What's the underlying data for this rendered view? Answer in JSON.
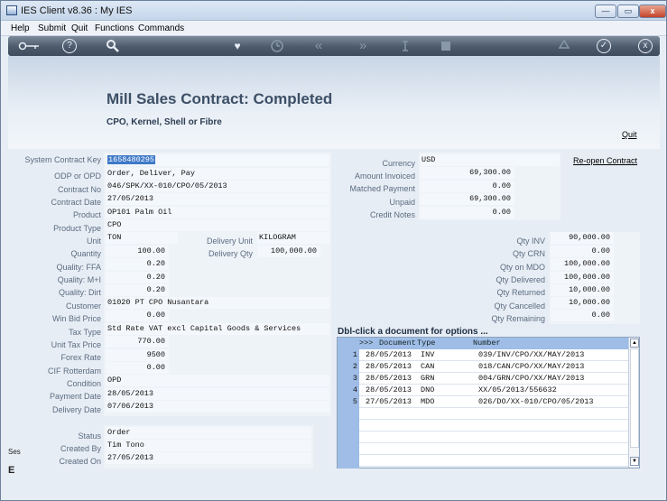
{
  "window": {
    "title": "IES Client v8.36 : My IES",
    "controls": {
      "minimize": "—",
      "maximize": "▭",
      "close": "x"
    }
  },
  "menu": [
    "Help",
    "Submit",
    "Quit",
    "Functions",
    "Commands"
  ],
  "toolbar": {
    "icons": [
      "key-icon",
      "help-icon",
      "search-icon",
      "heart-icon",
      "clock-icon",
      "rewind-icon",
      "forward-icon",
      "cursor-icon",
      "stop-icon",
      "recycle-icon",
      "check-icon",
      "close-icon"
    ],
    "help": "?",
    "fav": "♥",
    "rew": "«",
    "fwd": "»",
    "check": "✓",
    "close": "x"
  },
  "page": {
    "title": "Mill Sales Contract: Completed",
    "subtitle": "CPO, Kernel, Shell or Fibre",
    "quit": "Quit",
    "reopen": "Re-open Contract"
  },
  "left": {
    "system_contract_key": {
      "label": "System Contract Key",
      "value": "1658480295"
    },
    "odp": {
      "label": "ODP or OPD",
      "value": "Order, Deliver, Pay"
    },
    "contract_no": {
      "label": "Contract No",
      "value": "046/SPK/XX-010/CPO/05/2013"
    },
    "contract_date": {
      "label": "Contract Date",
      "value": "27/05/2013"
    },
    "product": {
      "label": "Product",
      "value": "OP101 Palm Oil"
    },
    "product_type": {
      "label": "Product Type",
      "value": "CPO"
    },
    "unit": {
      "label": "Unit",
      "value": "TON"
    },
    "delivery_unit": {
      "label": "Delivery Unit",
      "value": "KILOGRAM"
    },
    "quantity": {
      "label": "Quantity",
      "value": "100.00"
    },
    "delivery_qty": {
      "label": "Delivery Qty",
      "value": "100,000.00"
    },
    "ffa": {
      "label": "Quality: FFA",
      "value": "0.20"
    },
    "mi": {
      "label": "Quality: M+I",
      "value": "0.20"
    },
    "dirt": {
      "label": "Quality: Dirt",
      "value": "0.20"
    },
    "customer": {
      "label": "Customer",
      "value": "01020 PT CPO Nusantara"
    },
    "win_bid": {
      "label": "Win Bid Price",
      "value": "0.00"
    },
    "tax_type": {
      "label": "Tax Type",
      "value": "Std Rate VAT excl Capital Goods & Services"
    },
    "unit_tax": {
      "label": "Unit Tax Price",
      "value": "770.00"
    },
    "forex": {
      "label": "Forex Rate",
      "value": "9500"
    },
    "cif": {
      "label": "CIF Rotterdam",
      "value": "0.00"
    },
    "condition": {
      "label": "Condition",
      "value": "OPD"
    },
    "payment_date": {
      "label": "Payment Date",
      "value": "28/05/2013"
    },
    "delivery_date": {
      "label": "Delivery Date",
      "value": "07/06/2013"
    },
    "status": {
      "label": "Status",
      "value": "Order"
    },
    "created_by": {
      "label": "Created By",
      "value": "Tim Tono"
    },
    "created_on": {
      "label": "Created On",
      "value": "27/05/2013"
    }
  },
  "right": {
    "currency": {
      "label": "Currency",
      "value": "USD"
    },
    "amount_invoiced": {
      "label": "Amount Invoiced",
      "value": "69,300.00"
    },
    "matched_payment": {
      "label": "Matched Payment",
      "value": "0.00"
    },
    "unpaid": {
      "label": "Unpaid",
      "value": "69,300.00"
    },
    "credit_notes": {
      "label": "Credit Notes",
      "value": "0.00"
    },
    "qty_inv": {
      "label": "Qty INV",
      "value": "90,000.00"
    },
    "qty_crn": {
      "label": "Qty CRN",
      "value": "0.00"
    },
    "qty_mdo": {
      "label": "Qty on MDO",
      "value": "100,000.00"
    },
    "qty_delivered": {
      "label": "Qty Delivered",
      "value": "100,000.00"
    },
    "qty_returned": {
      "label": "Qty Returned",
      "value": "10,000.00"
    },
    "qty_cancelled": {
      "label": "Qty Cancelled",
      "value": "10,000.00"
    },
    "qty_remaining": {
      "label": "Qty Remaining",
      "value": "0.00"
    }
  },
  "grid": {
    "title": "Dbl-click a document for options ...",
    "headers": {
      "marker": ">>>",
      "document": "Document",
      "type": "Type",
      "number": "Number"
    },
    "rows": [
      {
        "n": "1",
        "date": "28/05/2013",
        "type": "INV",
        "number": "039/INV/CPO/XX/MAY/2013"
      },
      {
        "n": "2",
        "date": "28/05/2013",
        "type": "CAN",
        "number": "018/CAN/CPO/XX/MAY/2013"
      },
      {
        "n": "3",
        "date": "28/05/2013",
        "type": "GRN",
        "number": "004/GRN/CPO/XX/MAY/2013"
      },
      {
        "n": "4",
        "date": "28/05/2013",
        "type": "DNO",
        "number": "XX/05/2013/556632"
      },
      {
        "n": "5",
        "date": "27/05/2013",
        "type": "MDO",
        "number": "026/DO/XX-010/CPO/05/2013"
      }
    ],
    "scroll_up": "▲",
    "scroll_down": "▼"
  },
  "side": {
    "ses": "Ses",
    "e": "E"
  }
}
